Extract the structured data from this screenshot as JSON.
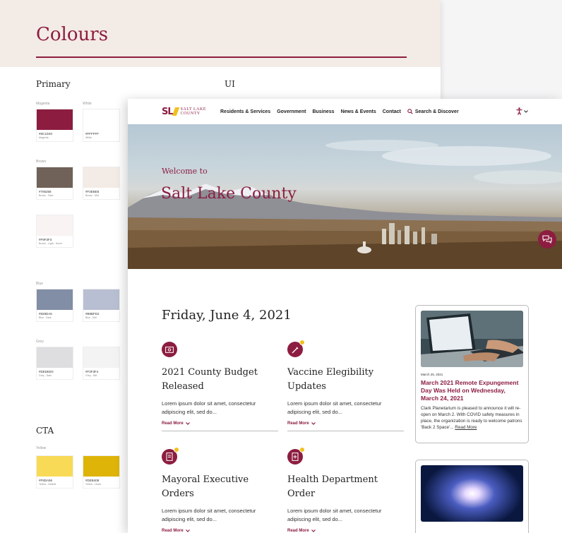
{
  "style_guide": {
    "title": "Colours",
    "sections": {
      "primary": "Primary",
      "ui": "UI",
      "cta": "CTA"
    },
    "groups": {
      "magenta": "Magenta",
      "white": "White",
      "brown": "Brown",
      "blue": "Blue",
      "grey": "Grey",
      "yellow": "Yellow"
    },
    "swatches": [
      {
        "hex": "#8C1D40",
        "name": "Magenta",
        "color": "#8c1d40"
      },
      {
        "hex": "#FFFFFF",
        "name": "White",
        "color": "#ffffff"
      },
      {
        "hex": "#706258",
        "name": "Brown - Dark",
        "color": "#706258"
      },
      {
        "hex": "#F3EBE5",
        "name": "Brown - Mid",
        "color": "#f3ebe5"
      },
      {
        "hex": "#F9F3F3",
        "name": "Brown - Light - Hover",
        "color": "#f9f3f3"
      },
      {
        "hex": "#828DA6",
        "name": "Blue - Dark",
        "color": "#828da6"
      },
      {
        "hex": "#B9BFD2",
        "name": "Blue - Mid",
        "color": "#b9bfd2"
      },
      {
        "hex": "#DEDEE0",
        "name": "Grey - Dark",
        "color": "#dedee0"
      },
      {
        "hex": "#F3F3F4",
        "name": "Grey - Mid",
        "color": "#f3f3f4"
      },
      {
        "hex": "#F8DA56",
        "name": "Yellow - Default",
        "color": "#f8da56"
      },
      {
        "hex": "#DEB408",
        "name": "Yellow - Hover",
        "color": "#deb408"
      }
    ]
  },
  "site": {
    "logo": {
      "mark": "SL",
      "line1": "SALT LAKE",
      "line2": "COUNTY"
    },
    "nav": [
      "Residents & Services",
      "Government",
      "Business",
      "News & Events",
      "Contact"
    ],
    "search_label": "Search & Discover",
    "hero": {
      "welcome": "Welcome to",
      "title": "Salt Lake County"
    },
    "date": "Friday, June 4, 2021",
    "cards": [
      {
        "title": "2021 County Budget Released",
        "body": "Lorem ipsum dolor sit amet, consectetur adipiscing elit, sed do...",
        "link": "Read More"
      },
      {
        "title": "Vaccine Elegibility Updates",
        "body": "Lorem ipsum dolor sit amet, consectetur adipiscing elit, sed do...",
        "link": "Read More"
      },
      {
        "title": "Mayoral Executive Orders",
        "body": "Lorem ipsum dolor sit amet, consectetur adipiscing elit, sed do...",
        "link": "Read More"
      },
      {
        "title": "Health Department Order",
        "body": "Lorem ipsum dolor sit amet, consectetur adipiscing elit, sed do...",
        "link": "Read More"
      }
    ],
    "news": {
      "date": "March 25, 2021",
      "title": "March 2021 Remote Expungement Day Was Held on Wednesday, March 24, 2021",
      "body": "Clark Planetarium is pleased to announce it will re-open on March 2. With COVID safety measures in place, the organization is ready to welcome patrons 'Back 2 Space'...",
      "link": "Read More"
    }
  },
  "colors": {
    "magenta": "#8C1D40",
    "brown_mid": "#F3EBE5",
    "yellow": "#F0C020"
  }
}
